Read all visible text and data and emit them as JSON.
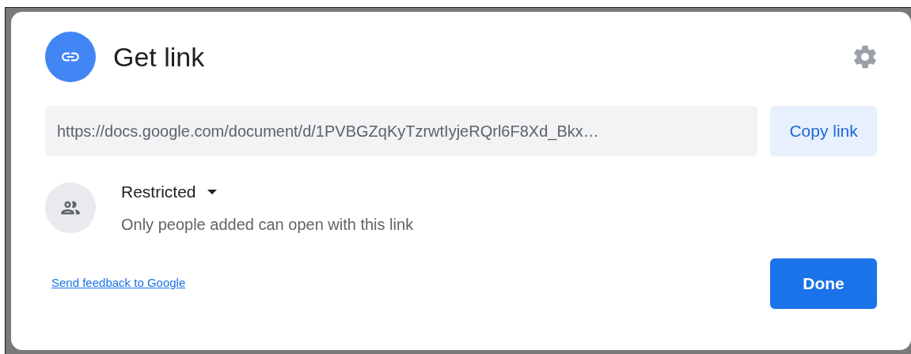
{
  "dialog": {
    "title": "Get link",
    "link": {
      "value": "https://docs.google.com/document/d/1PVBGZqKyTzrwtIyjeRQrl6F8Xd_Bkx…",
      "copy_button": "Copy link"
    },
    "access": {
      "level": "Restricted",
      "description": "Only people added can open with this link"
    },
    "feedback_link": "Send feedback to Google",
    "done_button": "Done"
  }
}
